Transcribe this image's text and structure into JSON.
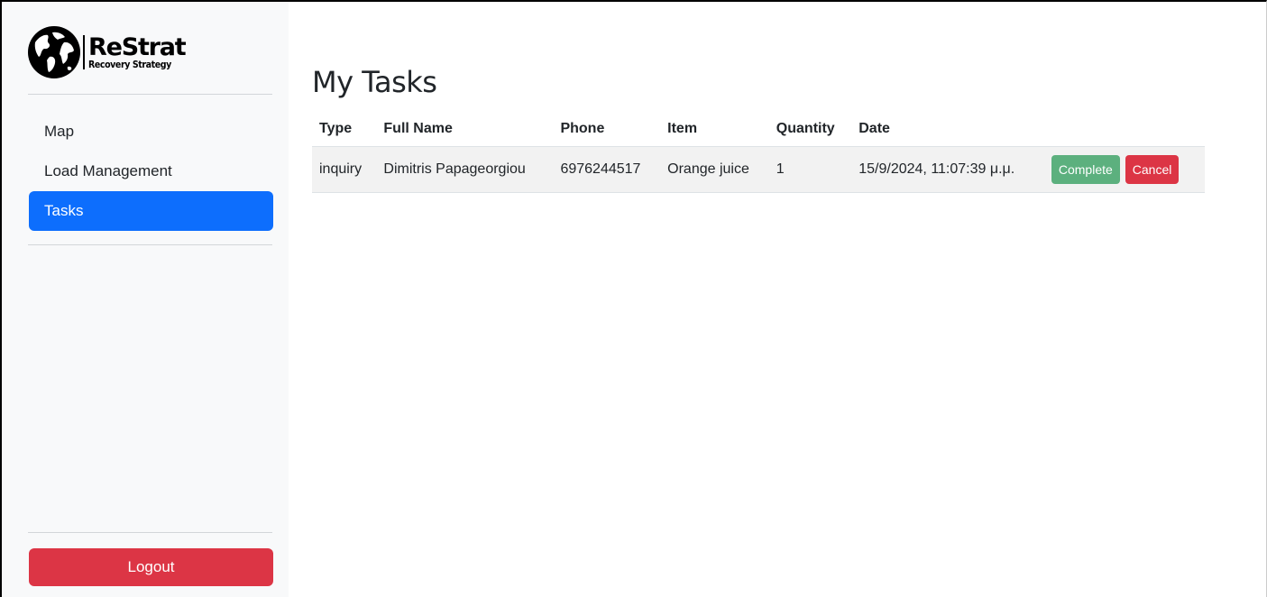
{
  "brand": {
    "title": "ReStrat",
    "subtitle": "Recovery Strategy",
    "logo_icon": "globe-icon"
  },
  "sidebar": {
    "items": [
      {
        "label": "Map",
        "active": false
      },
      {
        "label": "Load Management",
        "active": false
      },
      {
        "label": "Tasks",
        "active": true
      }
    ],
    "logout_label": "Logout"
  },
  "main": {
    "title": "My Tasks",
    "table": {
      "headers": [
        "Type",
        "Full Name",
        "Phone",
        "Item",
        "Quantity",
        "Date"
      ],
      "rows": [
        {
          "type": "inquiry",
          "full_name": "Dimitris Papageorgiou",
          "phone": "6976244517",
          "item": "Orange juice",
          "quantity": "1",
          "date": "15/9/2024, 11:07:39 μ.μ.",
          "complete_label": "Complete",
          "cancel_label": "Cancel"
        }
      ]
    }
  },
  "colors": {
    "primary": "#0d6efd",
    "danger": "#dc3545",
    "success_muted": "#5cb07e",
    "sidebar_bg": "#f8f9fa"
  }
}
